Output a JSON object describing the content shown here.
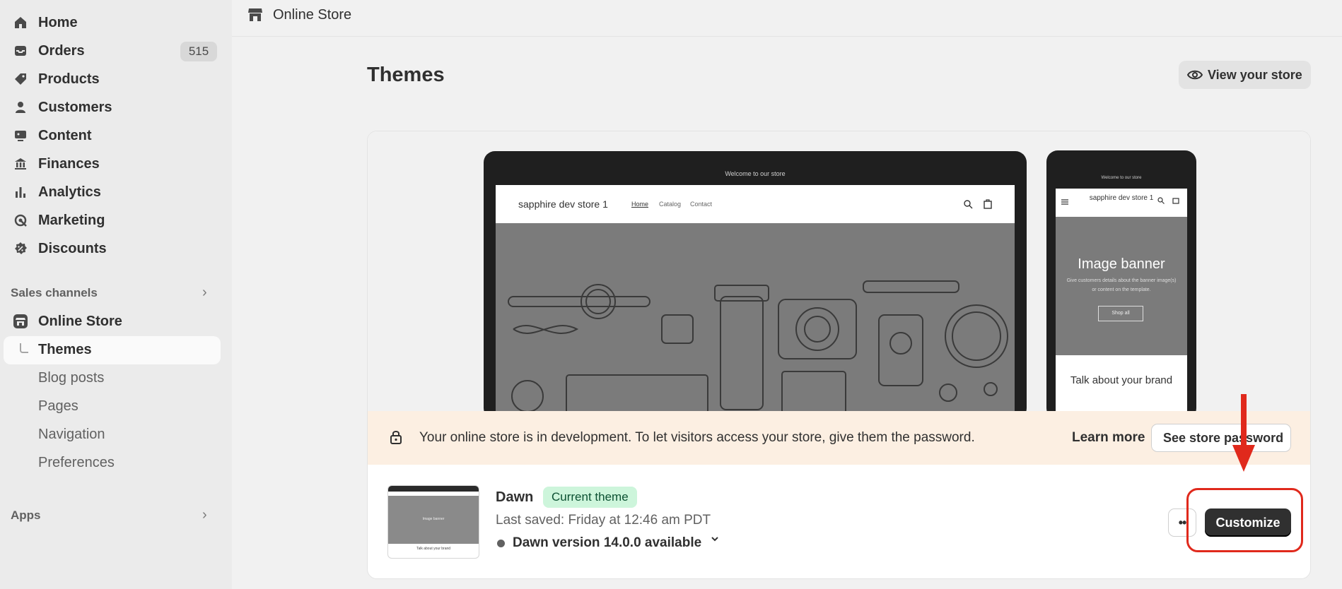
{
  "sidebar": {
    "main_items": [
      {
        "label": "Home",
        "icon": "home-icon"
      },
      {
        "label": "Orders",
        "icon": "inbox-icon"
      },
      {
        "label": "Products",
        "icon": "tag-icon"
      },
      {
        "label": "Customers",
        "icon": "person-icon"
      },
      {
        "label": "Content",
        "icon": "content-icon"
      },
      {
        "label": "Finances",
        "icon": "bank-icon"
      },
      {
        "label": "Analytics",
        "icon": "chart-bar-icon"
      },
      {
        "label": "Marketing",
        "icon": "target-icon"
      },
      {
        "label": "Discounts",
        "icon": "discount-icon"
      }
    ],
    "orders_count": "515",
    "sales_channels_label": "Sales channels",
    "online_store_label": "Online Store",
    "sub_items": [
      "Themes",
      "Blog posts",
      "Pages",
      "Navigation",
      "Preferences"
    ],
    "apps_label": "Apps"
  },
  "topbar": {
    "title": "Online Store"
  },
  "page": {
    "title": "Themes",
    "view_store_label": "View your store"
  },
  "preview": {
    "announcement": "Welcome to our store",
    "store_name": "sapphire dev store 1",
    "nav": [
      "Home",
      "Catalog",
      "Contact"
    ],
    "mobile_store_name": "sapphire dev store 1",
    "mobile_banner_title": "Image banner",
    "mobile_banner_text": "Give customers details about the banner image(s) or content on the template.",
    "mobile_button": "Shop all",
    "mobile_talk": "Talk about your brand"
  },
  "dev_banner": {
    "message": "Your online store is in development. To let visitors access your store, give them the password.",
    "learn_more": "Learn more",
    "password_button": "See store password"
  },
  "current_theme": {
    "name": "Dawn",
    "badge": "Current theme",
    "last_saved": "Last saved: Friday at 12:46 am PDT",
    "version_text": "Dawn version 14.0.0 available",
    "thumb_label": "Image banner",
    "thumb_talk": "Talk about your brand",
    "more_label": "••",
    "customize_label": "Customize"
  },
  "colors": {
    "annotation": "#e0291c",
    "badge_green": "#cdf5db",
    "banner_bg": "#fcefe2"
  }
}
